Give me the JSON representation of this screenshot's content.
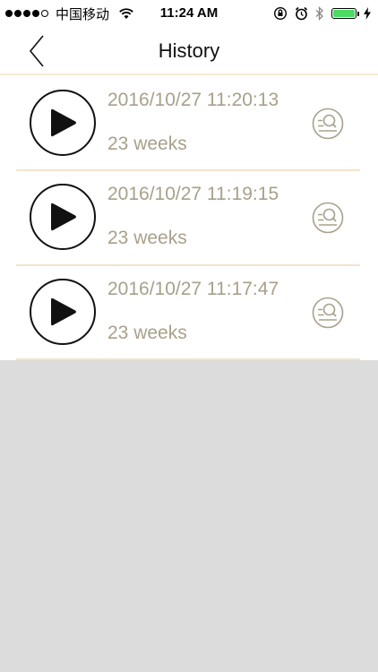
{
  "status": {
    "carrier": "中国移动",
    "time": "11:24 AM"
  },
  "nav": {
    "title": "History"
  },
  "records": [
    {
      "datetime": "2016/10/27 11:20:13",
      "weeks": "23 weeks"
    },
    {
      "datetime": "2016/10/27 11:19:15",
      "weeks": "23 weeks"
    },
    {
      "datetime": "2016/10/27 11:17:47",
      "weeks": "23 weeks"
    }
  ],
  "colors": {
    "accent": "#a8a08a",
    "divider": "#f3e4cc",
    "background": "#dcdcdc",
    "battery": "#4cd964"
  },
  "icons": {
    "back": "chevron-left-icon",
    "play": "play-icon",
    "search": "search-icon"
  }
}
